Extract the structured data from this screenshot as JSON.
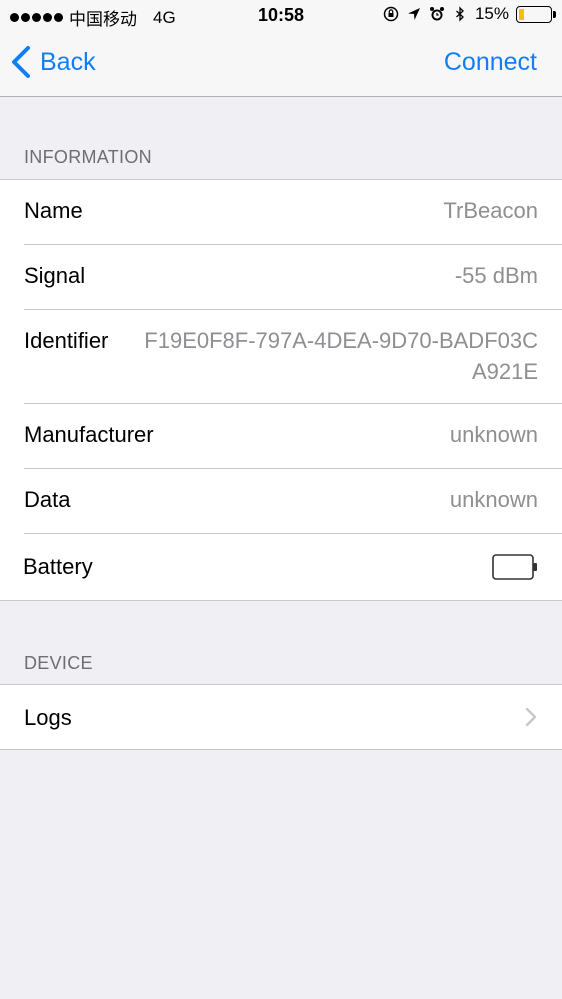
{
  "status_bar": {
    "carrier": "中国移动",
    "network": "4G",
    "time": "10:58",
    "battery_percent": "15%",
    "battery_level": 0.15,
    "battery_color": "#f2c200"
  },
  "nav": {
    "back_label": "Back",
    "action_label": "Connect",
    "accent_color": "#127ef6"
  },
  "sections": {
    "information": {
      "header": "INFORMATION",
      "rows": [
        {
          "label": "Name",
          "value": "TrBeacon"
        },
        {
          "label": "Signal",
          "value": "-55 dBm"
        },
        {
          "label": "Identifier",
          "value": "F19E0F8F-797A-4DEA-9D70-BADF03CA921E"
        },
        {
          "label": "Manufacturer",
          "value": "unknown"
        },
        {
          "label": "Data",
          "value": "unknown"
        },
        {
          "label": "Battery",
          "value_icon": "battery-empty-icon"
        }
      ]
    },
    "device": {
      "header": "DEVICE",
      "rows": [
        {
          "label": "Logs",
          "accessory": "chevron-right-icon"
        }
      ]
    }
  }
}
